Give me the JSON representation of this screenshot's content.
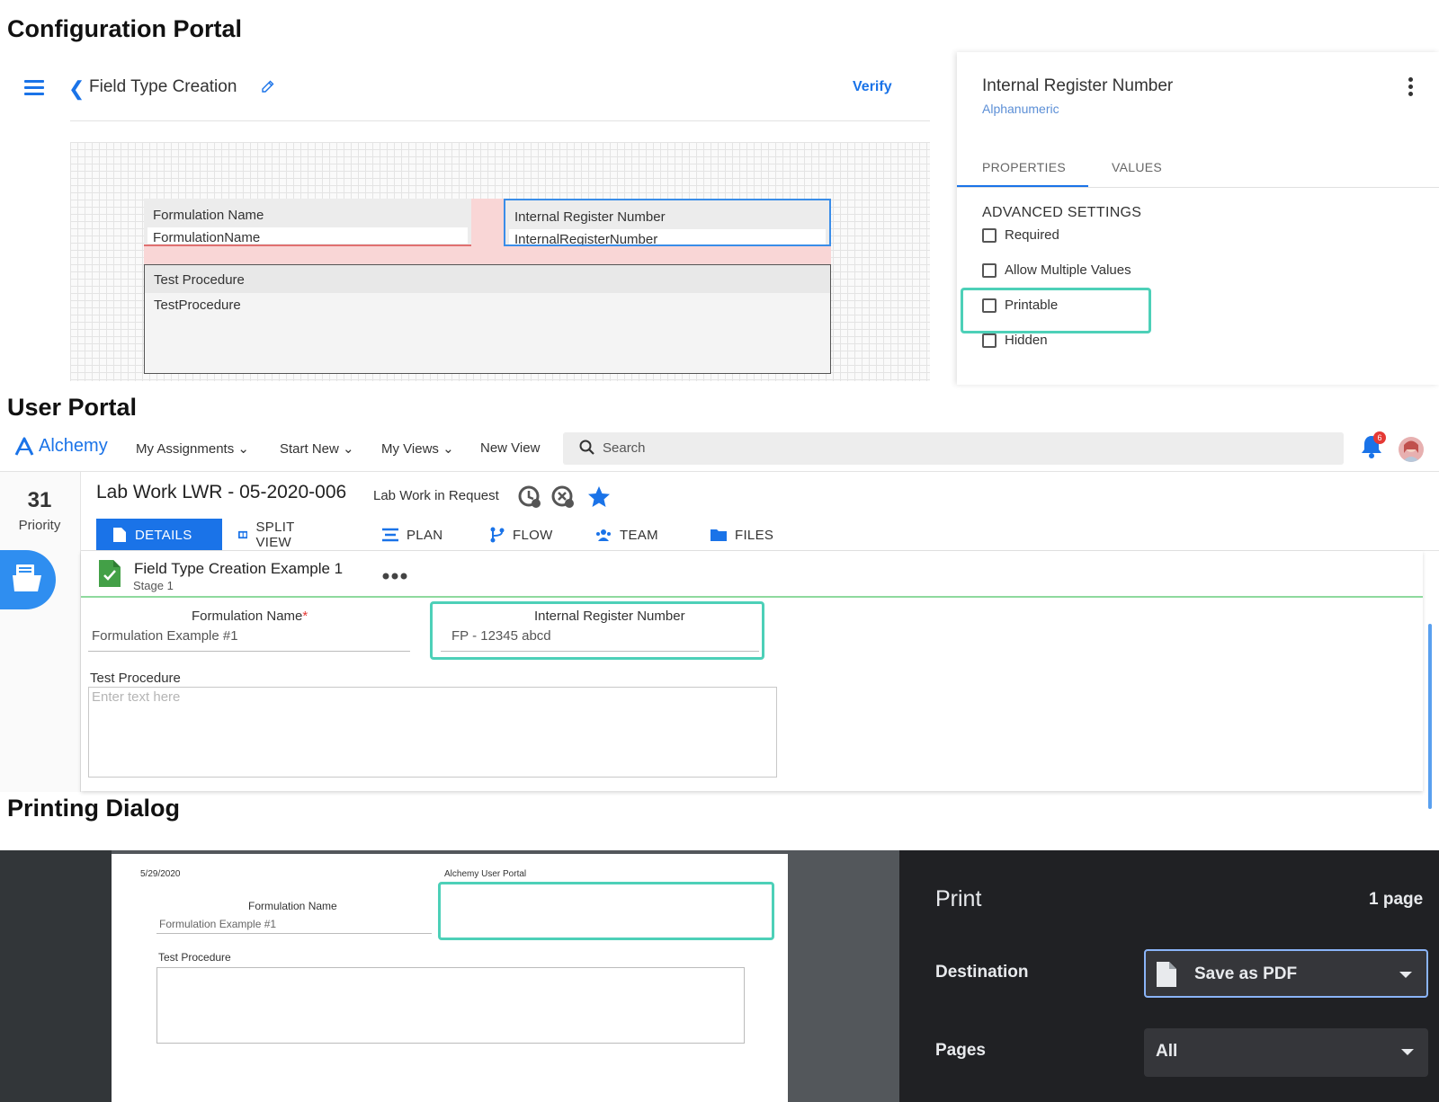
{
  "sections": {
    "config": "Configuration Portal",
    "user": "User Portal",
    "print": "Printing Dialog"
  },
  "config": {
    "title": "Field Type Creation",
    "verify": "Verify",
    "fields": [
      {
        "label": "Formulation Name",
        "value": "FormulationName"
      },
      {
        "label": "Internal Register Number",
        "value": "InternalRegisterNumber"
      },
      {
        "label": "Test Procedure",
        "value": "TestProcedure"
      }
    ],
    "panel": {
      "title": "Internal Register Number",
      "subtitle": "Alphanumeric",
      "tabs": [
        "PROPERTIES",
        "VALUES"
      ],
      "section": "ADVANCED SETTINGS",
      "checkboxes": [
        "Required",
        "Allow Multiple Values",
        "Printable",
        "Hidden"
      ]
    }
  },
  "user": {
    "logo": "Alchemy",
    "nav": [
      "My Assignments",
      "Start New",
      "My Views",
      "New View"
    ],
    "search_placeholder": "Search",
    "notif_count": "6",
    "priority_num": "31",
    "priority_label": "Priority",
    "record_title": "Lab Work LWR - 05-2020-006",
    "record_status": "Lab Work in Request",
    "tabs": [
      "DETAILS",
      "SPLIT VIEW",
      "PLAN",
      "FLOW",
      "TEAM",
      "FILES"
    ],
    "form_title": "Field Type Creation Example 1",
    "form_stage": "Stage 1",
    "field1_label": "Formulation Name",
    "field1_required": "*",
    "field1_value": "Formulation Example #1",
    "field2_label": "Internal Register Number",
    "field2_value": "FP - 12345 abcd",
    "field3_label": "Test Procedure",
    "field3_placeholder": "Enter text here"
  },
  "print": {
    "page": {
      "date": "5/29/2020",
      "header": "Alchemy User Portal",
      "field1_label": "Formulation Name",
      "field1_value": "Formulation Example #1",
      "field3_label": "Test Procedure"
    },
    "panel": {
      "title": "Print",
      "pages_count": "1 page",
      "destination_label": "Destination",
      "destination_value": "Save as PDF",
      "pages_label": "Pages",
      "pages_value": "All"
    }
  },
  "colors": {
    "accent": "#1a73e8",
    "highlight": "#4dd0b8",
    "required": "#e53935",
    "dark_panel": "#202124"
  }
}
